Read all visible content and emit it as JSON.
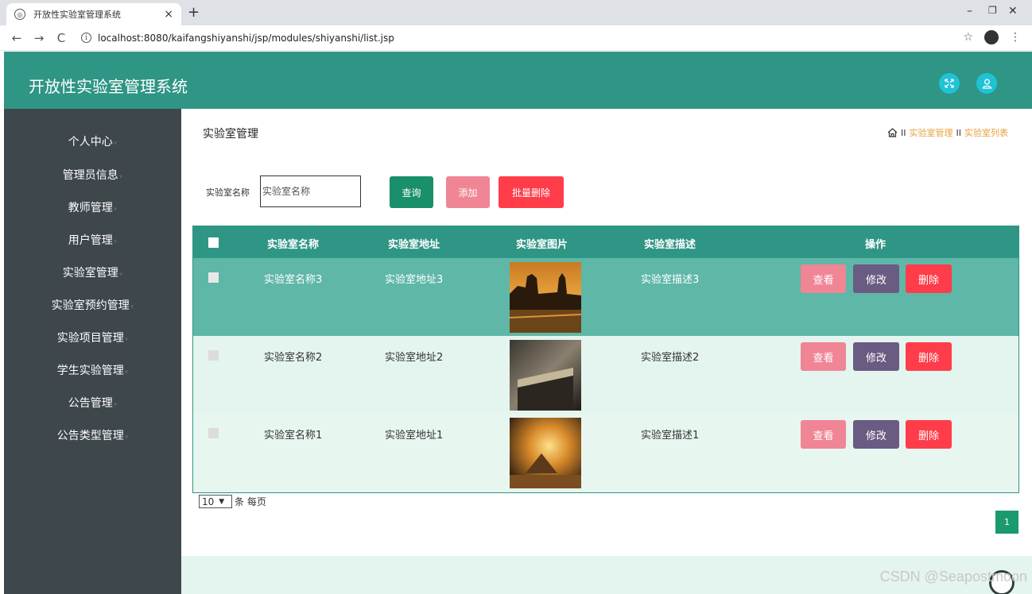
{
  "browser": {
    "tab_title": "开放性实验室管理系统",
    "tab_close": "×",
    "new_tab": "+",
    "url": "localhost:8080/kaifangshiyanshi/jsp/modules/shiyanshi/list.jsp",
    "back": "←",
    "forward": "→",
    "reload": "C",
    "star": "☆",
    "menu": "⋮",
    "win_min": "–",
    "win_max": "❐",
    "win_close": "✕"
  },
  "header": {
    "title": "开放性实验室管理系统"
  },
  "sidebar": {
    "items": [
      {
        "label": "个人中心"
      },
      {
        "label": "管理员信息"
      },
      {
        "label": "教师管理"
      },
      {
        "label": "用户管理"
      },
      {
        "label": "实验室管理"
      },
      {
        "label": "实验室预约管理"
      },
      {
        "label": "实验项目管理"
      },
      {
        "label": "学生实验管理"
      },
      {
        "label": "公告管理"
      },
      {
        "label": "公告类型管理"
      }
    ]
  },
  "main": {
    "page_title": "实验室管理",
    "breadcrumb": {
      "sep": "II",
      "crumbs": [
        "实验室管理",
        "实验室列表"
      ]
    },
    "search": {
      "label": "实验室名称",
      "placeholder": "实验室名称",
      "query_button": "查询",
      "add_button": "添加",
      "batch_delete_button": "批量删除"
    },
    "table": {
      "headers": [
        "实验室名称",
        "实验室地址",
        "实验室图片",
        "实验室描述",
        "操作"
      ],
      "rows": [
        {
          "name": "实验室名称3",
          "address": "实验室地址3",
          "desc": "实验室描述3",
          "selected": true
        },
        {
          "name": "实验室名称2",
          "address": "实验室地址2",
          "desc": "实验室描述2",
          "selected": false
        },
        {
          "name": "实验室名称1",
          "address": "实验室地址1",
          "desc": "实验室描述1",
          "selected": false
        }
      ],
      "actions": {
        "view": "查看",
        "edit": "修改",
        "delete": "删除"
      }
    },
    "pagination": {
      "page_size": "10",
      "page_size_suffix": "条 每页",
      "current_page": "1"
    }
  },
  "watermark": "CSDN @Seapostmoon",
  "colors": {
    "header": "#2f9585",
    "sidebar": "#3d474c",
    "view": "#f08596",
    "edit": "#6a5b82",
    "delete": "#ff3d4a",
    "breadcrumb": "#e6a23c"
  }
}
